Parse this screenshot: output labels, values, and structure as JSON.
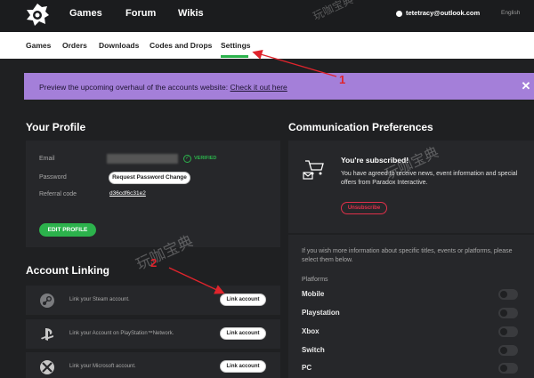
{
  "topnav": {
    "items": [
      "Games",
      "Forum",
      "Wikis"
    ],
    "user_email": "tetetracy@outlook.com",
    "language": "English"
  },
  "subnav": {
    "items": [
      "Games",
      "Orders",
      "Downloads",
      "Codes and Drops",
      "Settings"
    ],
    "active": "Settings"
  },
  "banner": {
    "text": "Preview the upcoming overhaul of the accounts website:",
    "link": "Check it out here",
    "close": "✕"
  },
  "profile": {
    "title": "Your Profile",
    "email_label": "Email",
    "verified": "VERIFIED",
    "password_label": "Password",
    "password_button": "Request Password Change",
    "referral_label": "Referral code",
    "referral_code": "d36cdf6c31e2",
    "edit_button": "EDIT PROFILE"
  },
  "account_linking": {
    "title": "Account Linking",
    "rows": [
      {
        "text": "Link your Steam account.",
        "button": "Link account",
        "icon": "steam-icon"
      },
      {
        "text": "Link your Account on PlayStation™Network.",
        "button": "Link account",
        "icon": "playstation-icon"
      },
      {
        "text": "Link your Microsoft account.",
        "button": "Link account",
        "icon": "xbox-icon"
      }
    ]
  },
  "communication": {
    "title": "Communication Preferences",
    "subscribed_title": "You're subscribed!",
    "subscribed_desc": "You have agreed to receive news, event information and special offers from Paradox Interactive.",
    "unsubscribe": "Unsubscribe",
    "more_info": "If you wish more information about specific titles, events or platforms, please select them below.",
    "platforms_label": "Platforms",
    "platforms": [
      "Mobile",
      "Playstation",
      "Xbox",
      "Switch",
      "PC"
    ]
  },
  "annotations": {
    "one": "1",
    "two": "2"
  },
  "watermark": "玩咖宝典",
  "colors": {
    "accent_green": "#2cb24c",
    "banner": "#a47fd9",
    "annotation": "#e0242c"
  }
}
